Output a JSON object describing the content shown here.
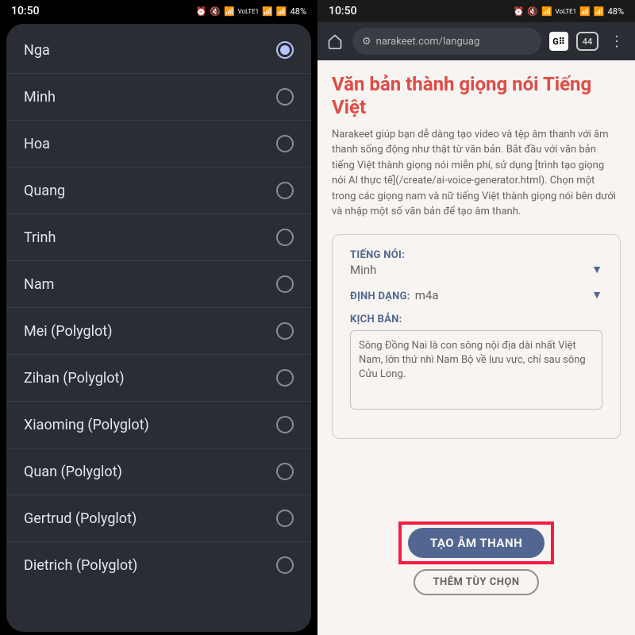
{
  "status": {
    "time": "10:50",
    "lte_label": "VoLTE1",
    "battery": "48%"
  },
  "picker": {
    "options": [
      {
        "label": "Nga",
        "selected": true
      },
      {
        "label": "Minh",
        "selected": false
      },
      {
        "label": "Hoa",
        "selected": false
      },
      {
        "label": "Quang",
        "selected": false
      },
      {
        "label": "Trinh",
        "selected": false
      },
      {
        "label": "Nam",
        "selected": false
      },
      {
        "label": "Mei (Polyglot)",
        "selected": false
      },
      {
        "label": "Zihan (Polyglot)",
        "selected": false
      },
      {
        "label": "Xiaoming (Polyglot)",
        "selected": false
      },
      {
        "label": "Quan (Polyglot)",
        "selected": false
      },
      {
        "label": "Gertrud (Polyglot)",
        "selected": false
      },
      {
        "label": "Dietrich (Polyglot)",
        "selected": false
      }
    ]
  },
  "browser": {
    "url": "narakeet.com/languag",
    "tab_count": "44",
    "translate_badge": "G⠿"
  },
  "page": {
    "title": "Văn bản thành giọng nói Tiếng Việt",
    "description": "Narakeet giúp bạn dễ dàng tạo video và tệp âm thanh với âm thanh sống động như thật từ văn bản. Bắt đầu với văn bản tiếng Việt thành giọng nói miễn phí, sử dụng [trình tạo giọng nói AI thực tế](/create/ai-voice-generator.html). Chọn một trong các giọng nam và nữ tiếng Việt thành giọng nói bên dưới và nhập một số văn bản để tạo âm thanh.",
    "form": {
      "voice_label": "TIẾNG NÓI:",
      "voice_value": "Minh",
      "format_label": "ĐỊNH DẠNG:",
      "format_value": "m4a",
      "script_label": "KỊCH BẢN:",
      "script_value": "Sông Đồng Nai là con sông nội địa dài nhất Việt Nam, lớn thứ nhì Nam Bộ về lưu vực, chỉ sau sông Cửu Long."
    },
    "buttons": {
      "create": "TẠO ÂM THANH",
      "options": "THÊM TÙY CHỌN"
    }
  }
}
